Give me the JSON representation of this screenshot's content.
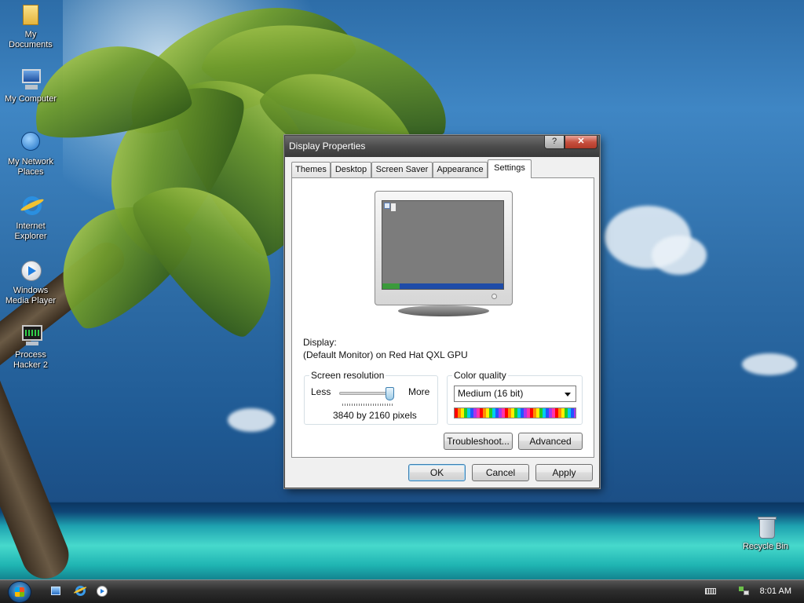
{
  "desktop": {
    "icons": [
      {
        "label_line1": "My",
        "label_line2": "Documents",
        "icon": "folder-documents-icon"
      },
      {
        "label_line1": "My Computer",
        "label_line2": "",
        "icon": "computer-icon"
      },
      {
        "label_line1": "My Network",
        "label_line2": "Places",
        "icon": "network-places-icon"
      },
      {
        "label_line1": "Internet",
        "label_line2": "Explorer",
        "icon": "internet-explorer-icon"
      },
      {
        "label_line1": "Windows",
        "label_line2": "Media Player",
        "icon": "media-player-icon"
      },
      {
        "label_line1": "Process",
        "label_line2": "Hacker 2",
        "icon": "process-hacker-icon"
      }
    ],
    "recycle_bin": {
      "label": "Recycle Bin",
      "icon": "recycle-bin-icon"
    }
  },
  "dialog": {
    "title": "Display Properties",
    "help_glyph": "?",
    "close_glyph": "✕",
    "tabs": [
      "Themes",
      "Desktop",
      "Screen Saver",
      "Appearance",
      "Settings"
    ],
    "active_tab": "Settings",
    "display_label": "Display:",
    "display_value": "(Default Monitor) on Red Hat QXL GPU",
    "resolution": {
      "caption": "Screen resolution",
      "less": "Less",
      "more": "More",
      "value_text": "3840 by 2160 pixels",
      "slider_level": 1.0
    },
    "color_quality": {
      "caption": "Color quality",
      "selected": "Medium (16 bit)"
    },
    "buttons": {
      "troubleshoot": "Troubleshoot...",
      "advanced": "Advanced",
      "ok": "OK",
      "cancel": "Cancel",
      "apply": "Apply"
    }
  },
  "taskbar": {
    "start": "start-orb-icon",
    "quick_launch": [
      "show-desktop-icon",
      "internet-explorer-icon",
      "media-player-icon"
    ],
    "tray": [
      "keyboard-icon",
      "network-icon"
    ],
    "clock": "8:01 AM"
  }
}
